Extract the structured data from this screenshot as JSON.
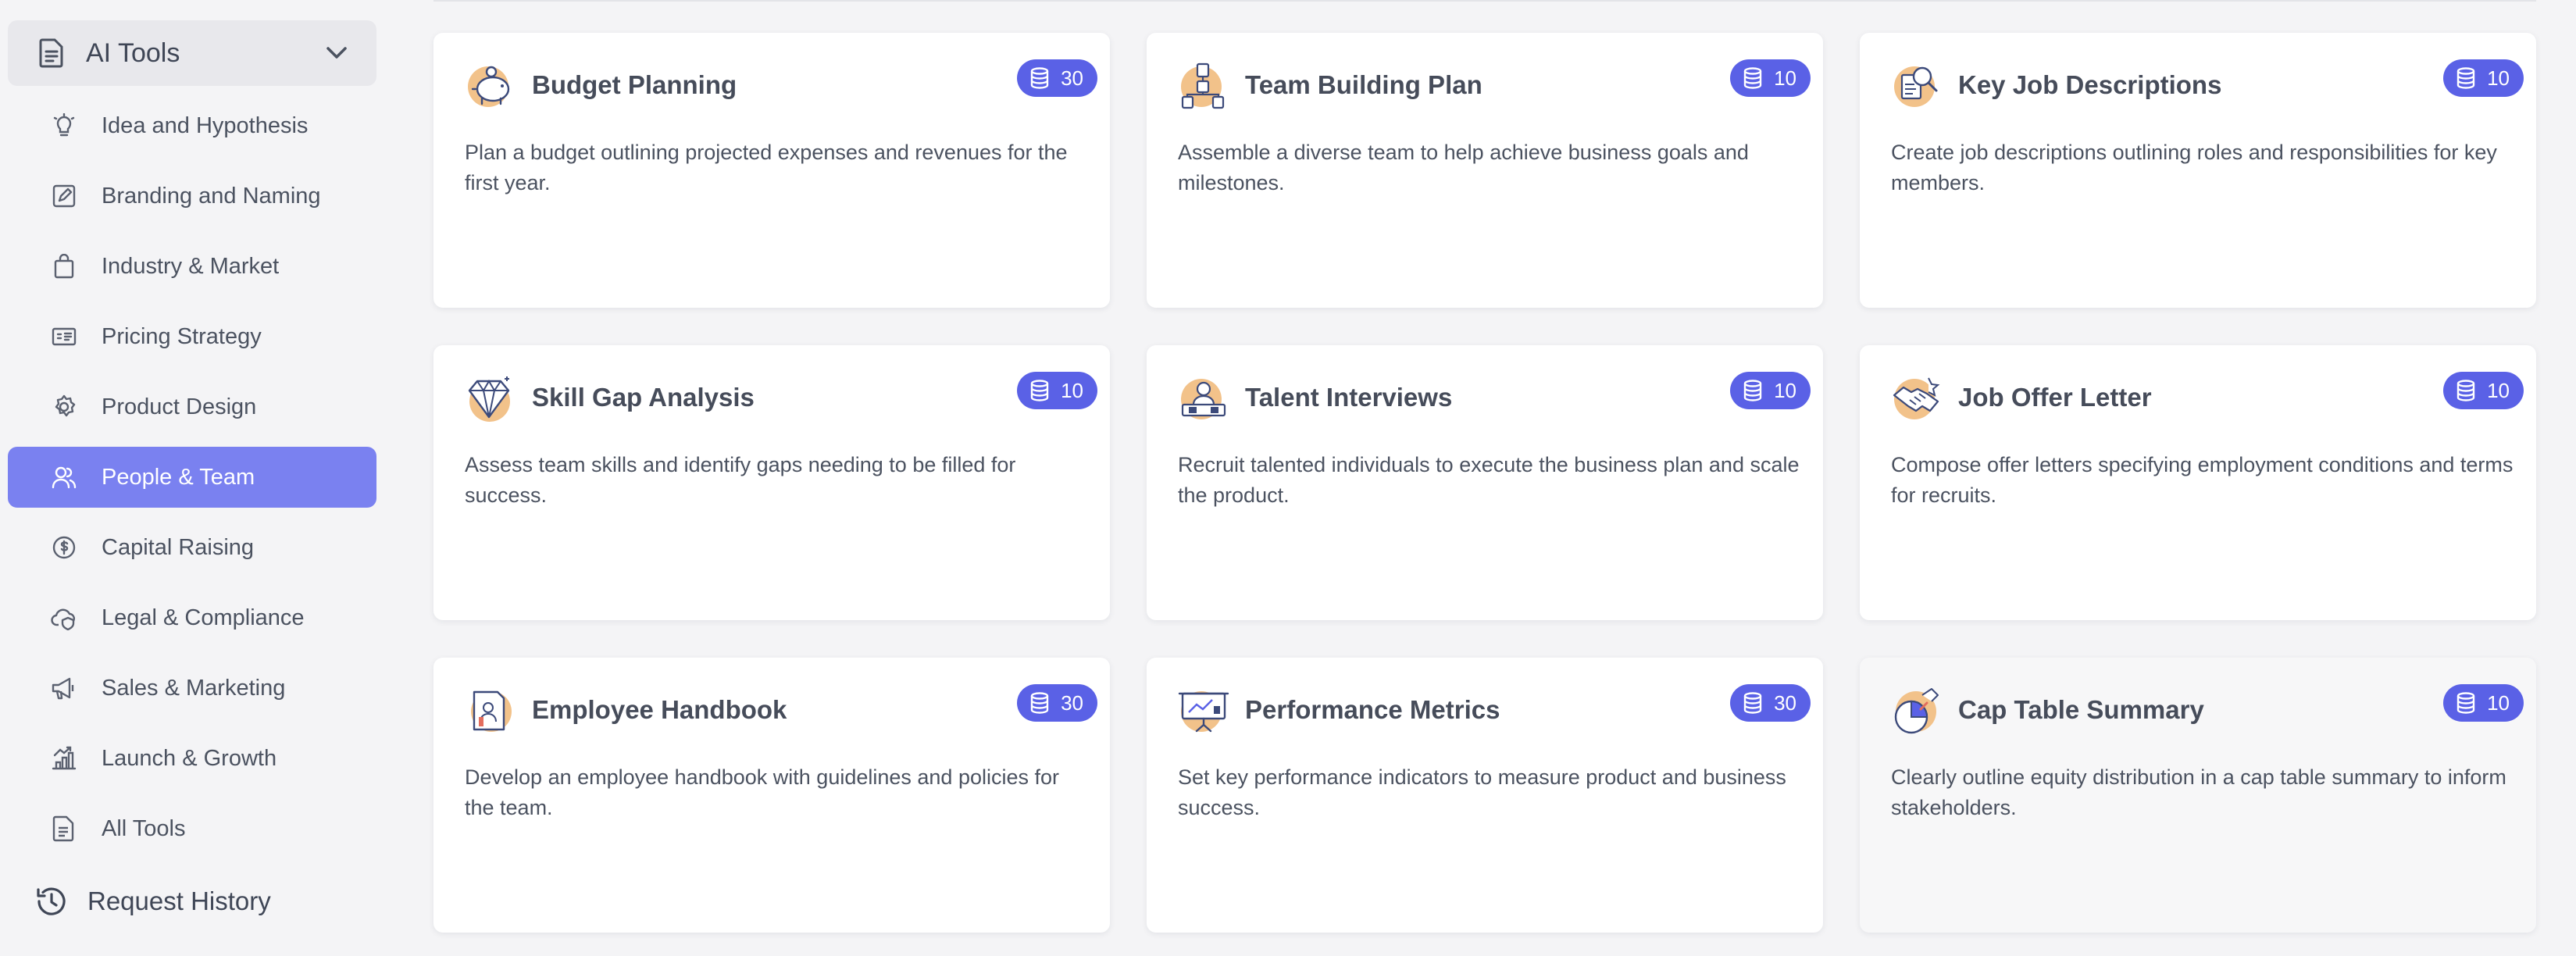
{
  "sidebar": {
    "header": {
      "title": "AI Tools",
      "icon": "document-icon"
    },
    "items": [
      {
        "label": "Idea and Hypothesis",
        "icon": "lightbulb-icon",
        "active": false
      },
      {
        "label": "Branding and Naming",
        "icon": "edit-square-icon",
        "active": false
      },
      {
        "label": "Industry & Market",
        "icon": "shopping-bag-icon",
        "active": false
      },
      {
        "label": "Pricing Strategy",
        "icon": "price-tag-icon",
        "active": false
      },
      {
        "label": "Product Design",
        "icon": "gear-icon",
        "active": false
      },
      {
        "label": "People & Team",
        "icon": "users-icon",
        "active": true
      },
      {
        "label": "Capital Raising",
        "icon": "dollar-coin-icon",
        "active": false
      },
      {
        "label": "Legal & Compliance",
        "icon": "cloud-shield-icon",
        "active": false
      },
      {
        "label": "Sales & Marketing",
        "icon": "megaphone-icon",
        "active": false
      },
      {
        "label": "Launch & Growth",
        "icon": "growth-chart-icon",
        "active": false
      },
      {
        "label": "All Tools",
        "icon": "file-icon",
        "active": false
      }
    ],
    "history": {
      "label": "Request History",
      "icon": "history-clock-icon"
    }
  },
  "cards": [
    {
      "title": "Budget Planning",
      "badge": "30",
      "icon": "piggy-bank-icon",
      "description": "Plan a budget outlining projected expenses and revenues for the first year."
    },
    {
      "title": "Team Building Plan",
      "badge": "10",
      "icon": "org-chart-icon",
      "description": "Assemble a diverse team to help achieve business goals and milestones."
    },
    {
      "title": "Key Job Descriptions",
      "badge": "10",
      "icon": "job-search-icon",
      "description": "Create job descriptions outlining roles and responsibilities for key members."
    },
    {
      "title": "Skill Gap Analysis",
      "badge": "10",
      "icon": "diamond-icon",
      "description": "Assess team skills and identify gaps needing to be filled for success."
    },
    {
      "title": "Talent Interviews",
      "badge": "10",
      "icon": "interview-icon",
      "description": "Recruit talented individuals to execute the business plan and scale the product."
    },
    {
      "title": "Job Offer Letter",
      "badge": "10",
      "icon": "handshake-icon",
      "description": "Compose offer letters specifying employment conditions and terms for recruits."
    },
    {
      "title": "Employee Handbook",
      "badge": "30",
      "icon": "handbook-icon",
      "description": "Develop an employee handbook with guidelines and policies for the team."
    },
    {
      "title": "Performance Metrics",
      "badge": "30",
      "icon": "presentation-board-icon",
      "description": "Set key performance indicators to measure product and business success."
    },
    {
      "title": "Cap Table Summary",
      "badge": "10",
      "icon": "pie-chart-icon",
      "description": "Clearly outline equity distribution in a cap table summary to inform stakeholders."
    }
  ],
  "colors": {
    "accent": "#7a81f0",
    "badge": "#5a61e6",
    "icon_orange": "#f2c28a",
    "icon_navy": "#3c4a7a"
  }
}
